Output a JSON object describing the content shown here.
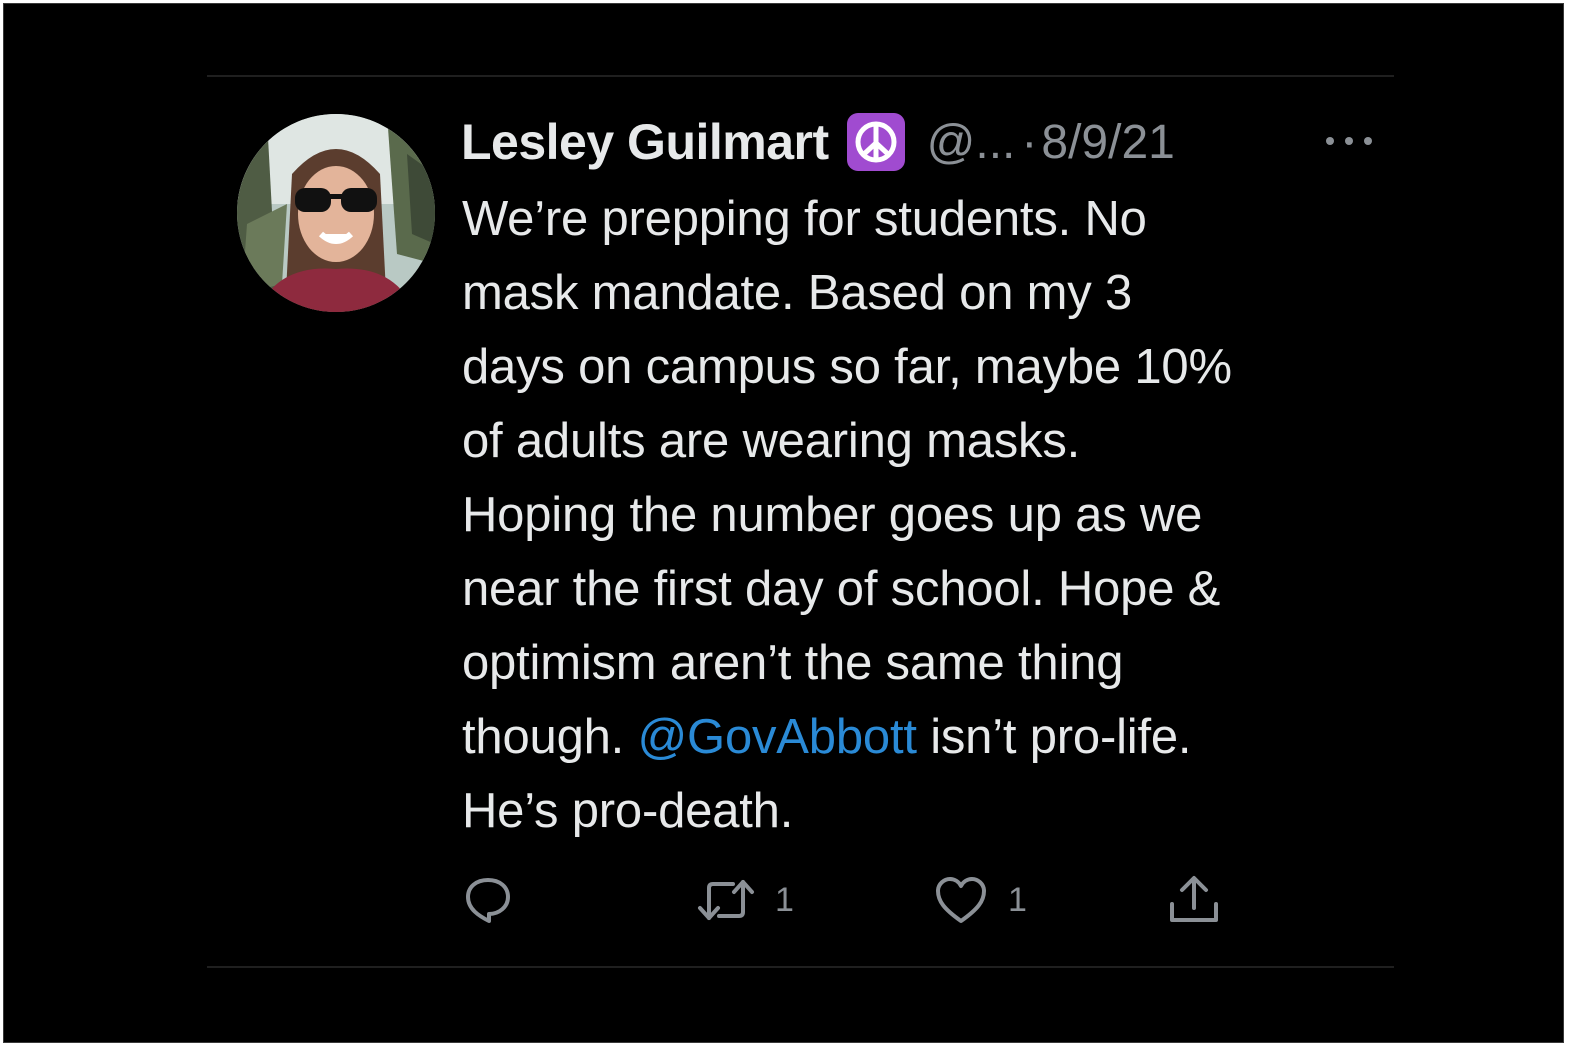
{
  "tweet": {
    "author": {
      "display_name": "Lesley Guilmart",
      "badge_emoji": "☮",
      "handle": "@...",
      "separator": "·",
      "date": "8/9/21",
      "avatar": "profile-photo-woman-sunglasses"
    },
    "text_lines": [
      "We’re prepping for students. No",
      "mask mandate. Based on my 3",
      "days on campus so far, maybe 10%",
      "of adults are wearing masks.",
      "Hoping the number goes up as we",
      "near the first day of school. Hope &",
      "optimism aren’t the same thing"
    ],
    "line8": {
      "before": "though. ",
      "mention": "@GovAbbott",
      "after": " isn’t pro-life."
    },
    "last_line": "He’s pro-death.",
    "actions": {
      "reply": {
        "icon": "reply-icon",
        "count": ""
      },
      "retweet": {
        "icon": "retweet-icon",
        "count": "1"
      },
      "like": {
        "icon": "heart-icon",
        "count": "1"
      },
      "share": {
        "icon": "share-icon"
      }
    },
    "more_icon": "ellipsis-icon"
  },
  "colors": {
    "background": "#000000",
    "text": "#e7e9ea",
    "secondary": "#8b9096",
    "mention": "#2a8ad6",
    "badge": "#a04bd0"
  }
}
